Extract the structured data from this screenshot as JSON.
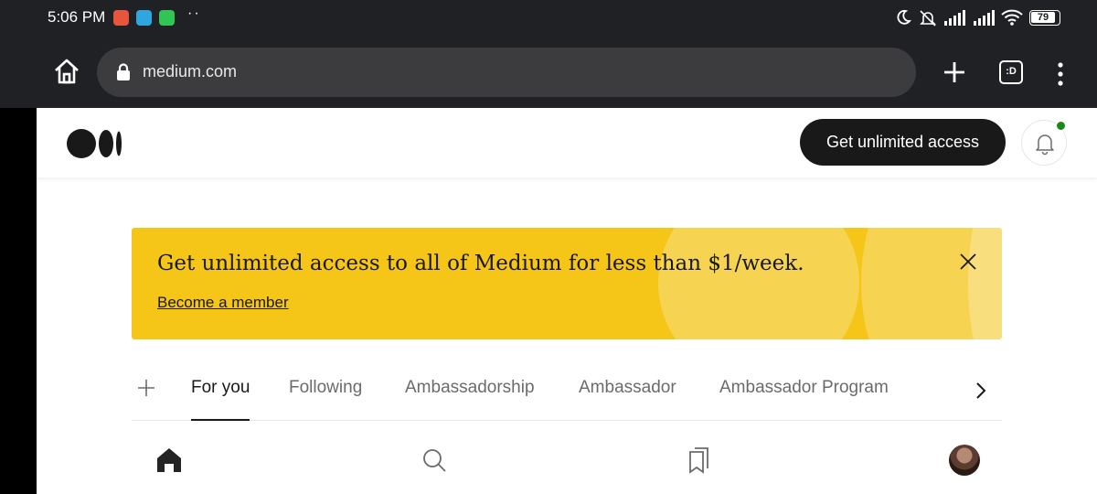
{
  "status_bar": {
    "time": "5:06 PM",
    "battery": "79",
    "app_icons": [
      "recorder-icon",
      "telegram-icon",
      "whatsapp-icon"
    ],
    "status_icons": [
      "moon-icon",
      "silent-icon",
      "signal-icon",
      "signal-icon",
      "wifi-icon",
      "battery-icon"
    ]
  },
  "browser": {
    "url": "medium.com",
    "tab_count_label": ":D"
  },
  "header": {
    "cta_label": "Get unlimited access"
  },
  "banner": {
    "text": "Get unlimited access to all of Medium for less than $1/week.",
    "link": "Become a member"
  },
  "tabs": {
    "items": [
      {
        "label": "For you",
        "active": true
      },
      {
        "label": "Following",
        "active": false
      },
      {
        "label": "Ambassadorship",
        "active": false
      },
      {
        "label": "Ambassador",
        "active": false
      },
      {
        "label": "Ambassador Program",
        "active": false
      }
    ]
  },
  "bottom_nav": [
    "home-icon",
    "search-icon",
    "bookmarks-icon",
    "avatar"
  ],
  "colors": {
    "banner": "#f5c518",
    "cta_bg": "#191919",
    "notification_dot": "#1a8917",
    "browser_chrome": "#202124"
  }
}
